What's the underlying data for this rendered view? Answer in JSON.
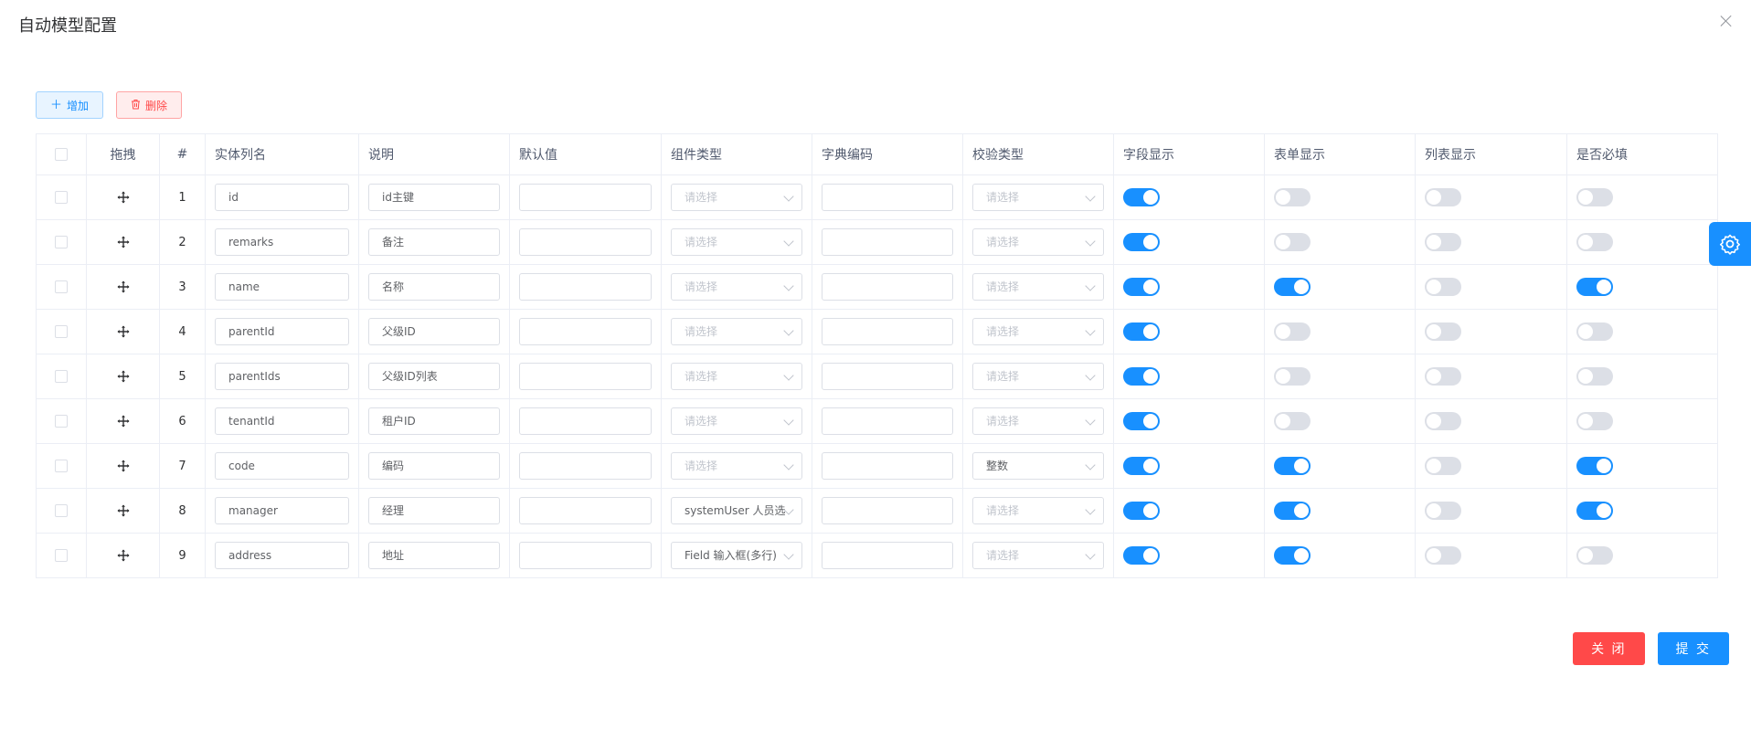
{
  "dialog": {
    "title": "自动模型配置"
  },
  "toolbar": {
    "add_label": "增加",
    "delete_label": "删除"
  },
  "columns": {
    "drag": "拖拽",
    "index": "#",
    "entity_name": "实体列名",
    "description": "说明",
    "default_value": "默认值",
    "component_type": "组件类型",
    "dict_code": "字典编码",
    "validation_type": "校验类型",
    "field_display": "字段显示",
    "form_display": "表单显示",
    "list_display": "列表显示",
    "required": "是否必填"
  },
  "select_placeholder": "请选择",
  "rows": [
    {
      "index": "1",
      "name": "id",
      "description": "id主键",
      "default_value": "",
      "component_type": "",
      "dict_code": "",
      "validation_type": "",
      "field_display": true,
      "form_display": false,
      "list_display": false,
      "required": false
    },
    {
      "index": "2",
      "name": "remarks",
      "description": "备注",
      "default_value": "",
      "component_type": "",
      "dict_code": "",
      "validation_type": "",
      "field_display": true,
      "form_display": false,
      "list_display": false,
      "required": false
    },
    {
      "index": "3",
      "name": "name",
      "description": "名称",
      "default_value": "",
      "component_type": "",
      "dict_code": "",
      "validation_type": "",
      "field_display": true,
      "form_display": true,
      "list_display": false,
      "required": true
    },
    {
      "index": "4",
      "name": "parentId",
      "description": "父级ID",
      "default_value": "",
      "component_type": "",
      "dict_code": "",
      "validation_type": "",
      "field_display": true,
      "form_display": false,
      "list_display": false,
      "required": false
    },
    {
      "index": "5",
      "name": "parentIds",
      "description": "父级ID列表",
      "default_value": "",
      "component_type": "",
      "dict_code": "",
      "validation_type": "",
      "field_display": true,
      "form_display": false,
      "list_display": false,
      "required": false
    },
    {
      "index": "6",
      "name": "tenantId",
      "description": "租户ID",
      "default_value": "",
      "component_type": "",
      "dict_code": "",
      "validation_type": "",
      "field_display": true,
      "form_display": false,
      "list_display": false,
      "required": false
    },
    {
      "index": "7",
      "name": "code",
      "description": "编码",
      "default_value": "",
      "component_type": "",
      "dict_code": "",
      "validation_type": "整数",
      "field_display": true,
      "form_display": true,
      "list_display": false,
      "required": true
    },
    {
      "index": "8",
      "name": "manager",
      "description": "经理",
      "default_value": "",
      "component_type": "systemUser 人员选",
      "dict_code": "",
      "validation_type": "",
      "field_display": true,
      "form_display": true,
      "list_display": false,
      "required": true
    },
    {
      "index": "9",
      "name": "address",
      "description": "地址",
      "default_value": "",
      "component_type": "Field 输入框(多行)",
      "dict_code": "",
      "validation_type": "",
      "field_display": true,
      "form_display": true,
      "list_display": false,
      "required": false
    }
  ],
  "footer": {
    "close_label": "关 闭",
    "submit_label": "提 交"
  },
  "icons": {
    "close": "close-icon",
    "add": "plus-icon",
    "delete": "trash-icon",
    "drag": "move-icon",
    "settings": "gear-icon",
    "dropdown": "chevron-down-icon"
  },
  "colors": {
    "primary": "#1890ff",
    "danger": "#ff4949",
    "switch_off": "#dcdfe6",
    "border": "#ebeef5"
  }
}
